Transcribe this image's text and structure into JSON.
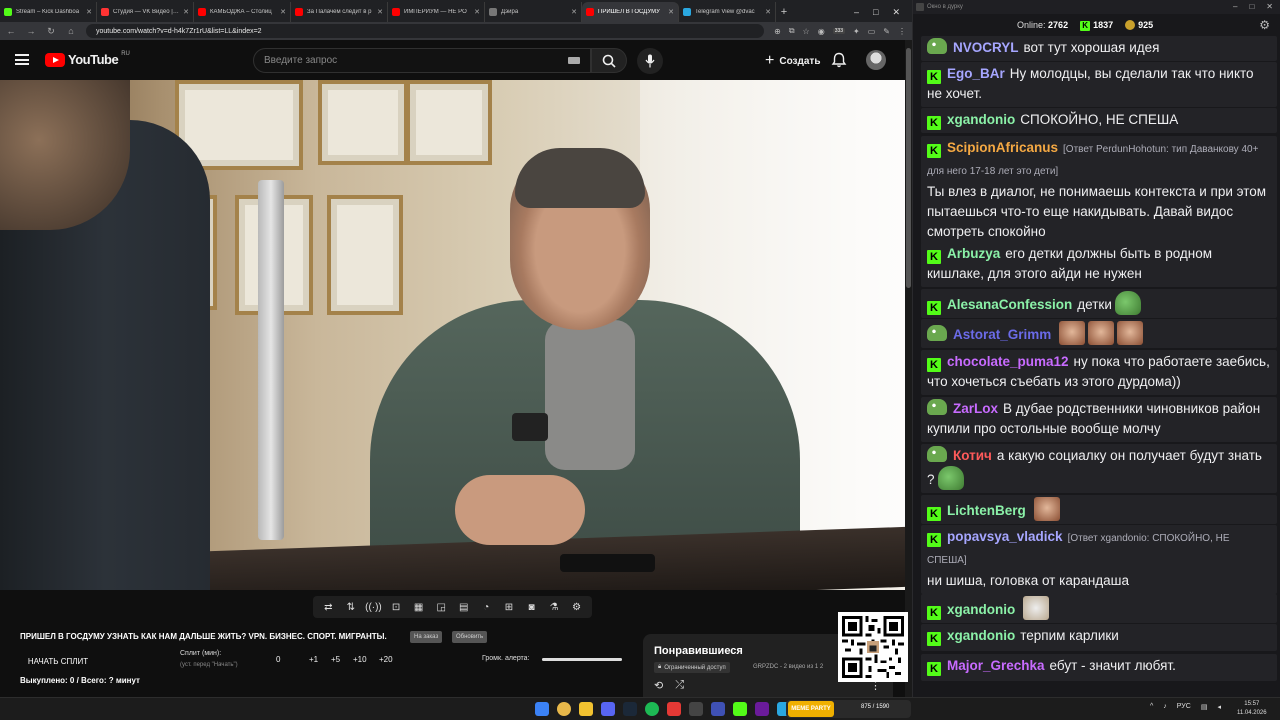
{
  "browser": {
    "tabs": [
      {
        "label": "Stream – Kick Dashboa",
        "color": "#53fc18",
        "active": false
      },
      {
        "label": "Студия — VK Видео | Lo",
        "color": "#ff3333",
        "active": false
      },
      {
        "label": "КАМБОДЖА – Столиц",
        "color": "#ff0000",
        "active": false
      },
      {
        "label": "За Палачем следит в р",
        "color": "#ff0000",
        "active": false
      },
      {
        "label": "ИМПЕРИУМ — НЕ PO",
        "color": "#ff0000",
        "active": false
      },
      {
        "label": "Дэйра",
        "color": "#777777",
        "active": false
      },
      {
        "label": "ПРИШЕЛ В ГОСДУМУ",
        "color": "#ff0000",
        "active": true
      },
      {
        "label": "Telegram View @dvac",
        "color": "#2aa7e0",
        "active": false
      }
    ],
    "new_tab": "+",
    "url": "youtube.com/watch?v=d-h4k7Zr1rU&list=LL&index=2",
    "ext_badge": "333"
  },
  "youtube": {
    "logo_text": "YouTube",
    "logo_region": "RU",
    "search_placeholder": "Введите запрос",
    "create_label": "Создать"
  },
  "video_tools": [
    "repeat",
    "sort",
    "broadcast",
    "screenshot-video",
    "clapper",
    "frame",
    "pip",
    "speed",
    "plus-frame",
    "camera",
    "flask",
    "gear"
  ],
  "below_video": {
    "title": "ПРИШЕЛ В ГОСДУМУ УЗНАТЬ КАК НАМ ДАЛЬШЕ ЖИТЬ? VPN. БИЗНЕС. СПОРТ. МИГРАНТЫ.",
    "pill1": "На заказ",
    "pill2": "Обновить",
    "split_button": "НАЧАТЬ СПЛИТ",
    "split_label": "Сплит (мин):",
    "split_sub": "(уст. перед \"Начать\")",
    "split_values": [
      "0",
      "+1",
      "+5",
      "+10",
      "+20"
    ],
    "alert_label": "Громк. алерта:",
    "alert_volume": 1.0,
    "counter": "Выкуплено: 0 / Всего: ? минут"
  },
  "liked": {
    "title": "Понравившиеся",
    "limited": "Ограниченный доступ",
    "meta": "GRPZDC - 2 видео из 1 2"
  },
  "chat": {
    "window_title": "Окно в дурку",
    "online_label": "Online:",
    "online_value": "2762",
    "kick_value": "1837",
    "coin_value": "925",
    "messages": [
      {
        "badge": "pepe",
        "user": "NVOCRYL",
        "color": "#a6a6ff",
        "text": "вот тут хорошая идея"
      },
      {
        "badge": "kick",
        "user": "Ego_BAr",
        "color": "#a6a6ff",
        "text": "Ну молодцы, вы сделали так что никто не хочет."
      },
      {
        "badge": "kick",
        "user": "xgandonio",
        "color": "#8bf1a8",
        "text": "СПОКОЙНО, НЕ СПЕША"
      },
      {
        "badge": "kick",
        "user": "ScipionAfricanus",
        "color": "#f4a843",
        "reply": "[Ответ PerdunHohotun: тип Даванкову 40+ для него 17-18 лет это дети]",
        "text": "Ты влез в диалог, не понимаешь контекста и при этом пытаешься что-то еще накидывать. Давай видос смотреть спокойно"
      },
      {
        "badge": "kick",
        "user": "Arbuzya",
        "color": "#8bf1a8",
        "text": "его детки должны быть в родном кишлаке, для этого айди не нужен"
      },
      {
        "badge": "kick",
        "user": "AlesanaConfession",
        "color": "#8bf1a8",
        "text": "детки",
        "emotes": [
          "pepe"
        ]
      },
      {
        "badge": "pepe",
        "user": "Astorat_Grimm",
        "color": "#6b6be8",
        "text": "",
        "emotes": [
          "face",
          "face",
          "face"
        ]
      },
      {
        "badge": "kick",
        "user": "chocolate_puma12",
        "color": "#c86bff",
        "text": "ну пока что работаете заебись, что хочеться съебать из этого дурдома))"
      },
      {
        "badge": "pepe",
        "user": "ZarLox",
        "color": "#c86bff",
        "text": "В дубае родственники чиновников район купили про остольные вообще молчу"
      },
      {
        "badge": "pepe",
        "user": "Котич",
        "color": "#ff5a5a",
        "text": "а какую социалку он  получает будут знать ?",
        "emotes": [
          "pepe"
        ]
      },
      {
        "badge": "kick",
        "user": "LichtenBerg",
        "color": "#8bf1a8",
        "text": "",
        "emotes": [
          "face"
        ]
      },
      {
        "badge": "kick",
        "user": "popavsya_vladick",
        "color": "#a6a6ff",
        "reply": "[Ответ xgandonio: СПОКОЙНО, НЕ СПЕША]",
        "text": "ни шиша, головка от карандаша"
      },
      {
        "badge": "kick",
        "user": "xgandonio",
        "color": "#8bf1a8",
        "text": "",
        "emotes": [
          "cat"
        ]
      },
      {
        "badge": "kick",
        "user": "xgandonio",
        "color": "#8bf1a8",
        "text": "терпим карлики"
      },
      {
        "badge": "kick",
        "user": "Major_Grechka",
        "color": "#c86bff",
        "text": "ебут - значит любят."
      }
    ]
  },
  "taskbar": {
    "pill_logo": "MEME PARTY",
    "pill_count": "875 / 1590",
    "lang": "РУС",
    "time": "15:57",
    "date": "11.04.2026"
  },
  "colors": {
    "kick_green": "#53fc18",
    "youtube_red": "#ff0000",
    "chat_bg": "#18181b"
  }
}
